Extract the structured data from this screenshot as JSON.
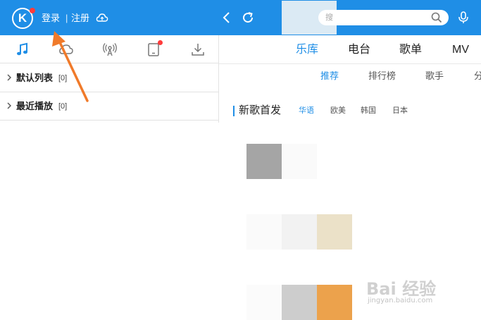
{
  "header": {
    "logo_letter": "K",
    "login": "登录",
    "separator": "|",
    "register": "注册",
    "search_placeholder": "搜"
  },
  "left_panel": {
    "tabs": [
      "music-note-icon",
      "cloud-icon",
      "radio-icon",
      "device-icon",
      "download-icon"
    ],
    "lists": [
      {
        "label": "默认列表",
        "count": "[0]"
      },
      {
        "label": "最近播放",
        "count": "[0]"
      }
    ]
  },
  "main": {
    "tabs": [
      {
        "label": "乐库",
        "active": true
      },
      {
        "label": "电台",
        "active": false
      },
      {
        "label": "歌单",
        "active": false
      },
      {
        "label": "MV",
        "active": false
      }
    ],
    "sub_tabs": [
      {
        "label": "推荐",
        "active": true
      },
      {
        "label": "排行榜",
        "active": false
      },
      {
        "label": "歌手",
        "active": false
      },
      {
        "label": "分",
        "active": false
      }
    ],
    "section": {
      "title": "新歌首发",
      "filters": [
        {
          "label": "华语",
          "active": true
        },
        {
          "label": "欧美",
          "active": false
        },
        {
          "label": "韩国",
          "active": false
        },
        {
          "label": "日本",
          "active": false
        }
      ]
    }
  },
  "watermark": {
    "brand": "Bai 经验",
    "url": "jingyan.baidu.com"
  },
  "colors": {
    "accent": "#1f8ee6",
    "badge": "#ff3b3b",
    "arrow": "#f07a2a"
  }
}
